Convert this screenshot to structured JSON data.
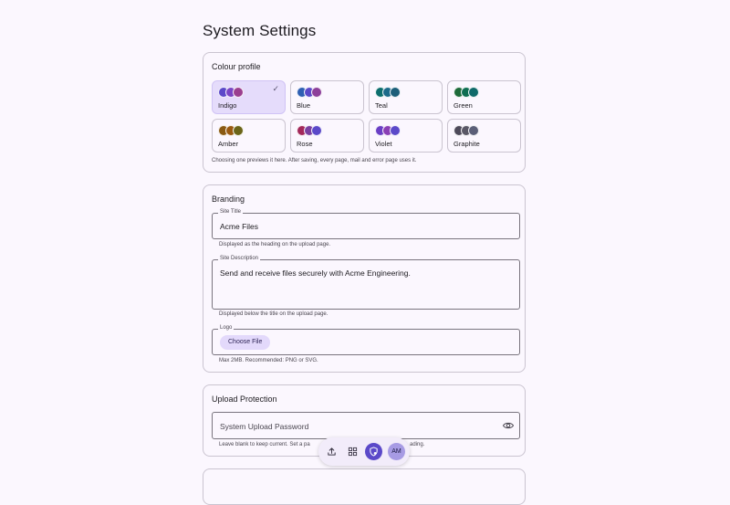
{
  "page": {
    "title": "System Settings"
  },
  "colour_profile": {
    "title": "Colour profile",
    "hint": "Choosing one previews it here. After saving, every page, mail and error page uses it.",
    "selected": "Indigo",
    "options": [
      {
        "label": "Indigo",
        "colors": [
          "#5b49c9",
          "#7a46c5",
          "#9b3f8f"
        ]
      },
      {
        "label": "Blue",
        "colors": [
          "#2e5fb3",
          "#5b49c9",
          "#8d3f9a"
        ]
      },
      {
        "label": "Teal",
        "colors": [
          "#0d6e6e",
          "#1b6a8a",
          "#1d5f7a"
        ]
      },
      {
        "label": "Green",
        "colors": [
          "#1e6b3a",
          "#0f6e52",
          "#0f6a6a"
        ]
      },
      {
        "label": "Amber",
        "colors": [
          "#8a5a12",
          "#9a5a10",
          "#6b6418"
        ]
      },
      {
        "label": "Rose",
        "colors": [
          "#a3285a",
          "#7a3fa0",
          "#5b49c9"
        ]
      },
      {
        "label": "Violet",
        "colors": [
          "#6a3fc5",
          "#8a3fb5",
          "#5b49c9"
        ]
      },
      {
        "label": "Graphite",
        "colors": [
          "#4e4a5a",
          "#5a5866",
          "#5b5f78"
        ]
      }
    ]
  },
  "branding": {
    "title": "Branding",
    "site_title": {
      "legend": "Site Title",
      "value": "Acme Files",
      "hint": "Displayed as the heading on the upload page."
    },
    "site_description": {
      "legend": "Site Description",
      "value": "Send and receive files securely with Acme Engineering.",
      "hint": "Displayed below the title on the upload page."
    },
    "logo": {
      "legend": "Logo",
      "button": "Choose File",
      "hint": "Max 2MB. Recommended: PNG or SVG."
    }
  },
  "upload_protection": {
    "title": "Upload Protection",
    "password": {
      "placeholder": "System Upload Password",
      "hint_start": "Leave blank to keep current. Set a pa",
      "hint_end": "ading.",
      "eye_icon": "eye-icon"
    }
  },
  "dock": {
    "items": [
      {
        "name": "upload-icon"
      },
      {
        "name": "grid-icon"
      },
      {
        "name": "shield-icon",
        "active": true
      },
      {
        "name": "avatar",
        "initials": "AM"
      }
    ]
  }
}
